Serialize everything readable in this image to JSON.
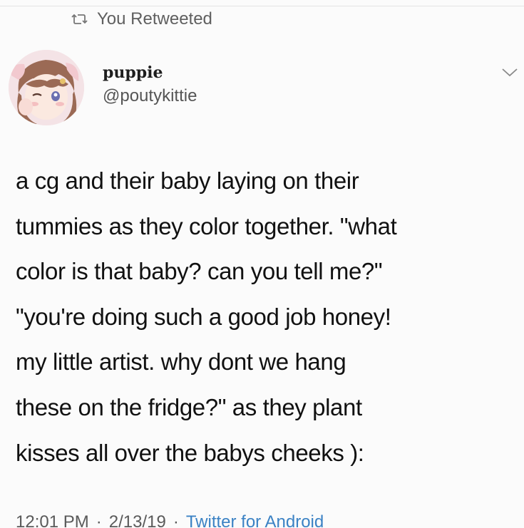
{
  "retweet": {
    "label": "You Retweeted"
  },
  "author": {
    "display_name": "puppie",
    "handle": "@poutykittie"
  },
  "tweet": {
    "lines": [
      "a cg and their baby laying on their",
      "tummies as they color together. \"what",
      "color is that baby? can you tell me?\"",
      "\"you're doing such a good job honey!",
      "my little artist. why dont we hang",
      "these on the fridge?\" as they plant",
      "kisses all over the babys cheeks ):"
    ]
  },
  "meta": {
    "time": "12:01 PM",
    "separator": "·",
    "date": "2/13/19",
    "source": "Twitter for Android"
  },
  "icons": {
    "retweet": "retweet-icon",
    "more": "chevron-down-icon",
    "avatar": "avatar-image"
  },
  "colors": {
    "link": "#3b82c4",
    "secondary_text": "#5f5f5f"
  }
}
